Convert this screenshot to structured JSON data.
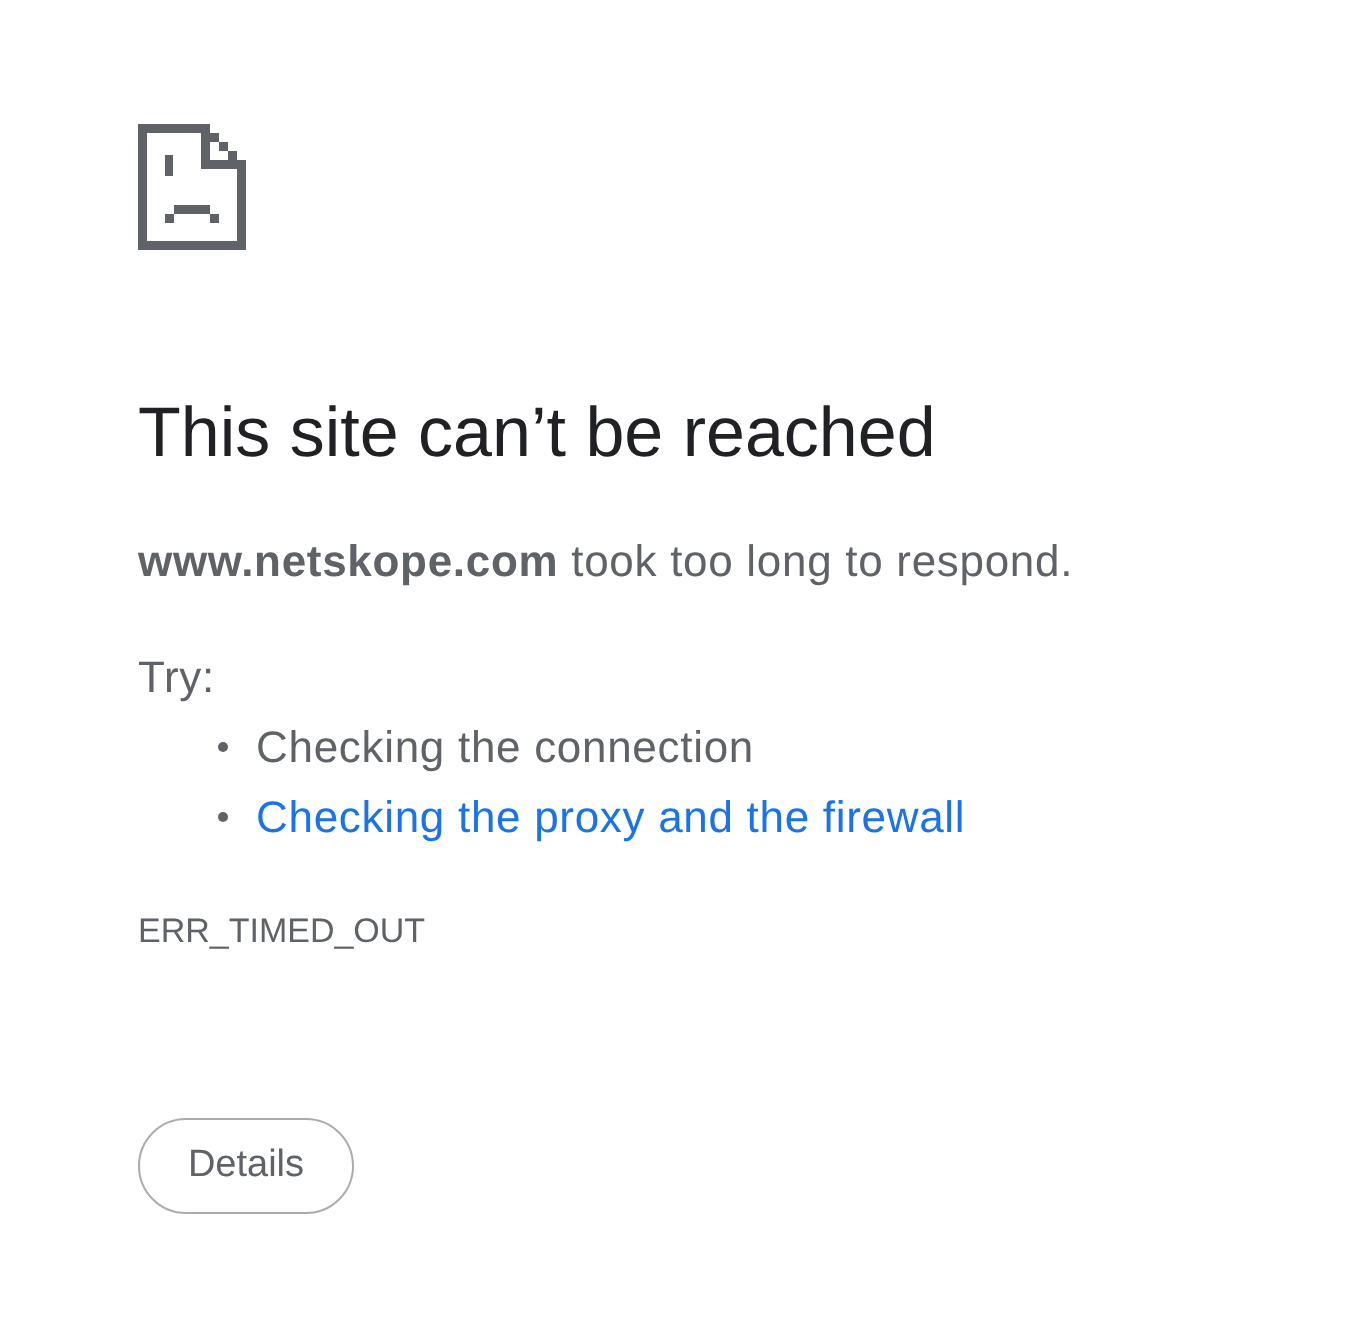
{
  "error": {
    "title": "This site can’t be reached",
    "message": "**www.netskope.com** took too long to respond.",
    "suggestions_heading": "Try:",
    "suggestions": [
      {
        "kind": "plain",
        "text": "Checking the connection"
      },
      {
        "kind": "link",
        "text": "Checking the proxy and the firewall"
      }
    ],
    "error_code": "ERR_TIMED_OUT"
  },
  "buttons": [
    {
      "label": "Details"
    }
  ]
}
